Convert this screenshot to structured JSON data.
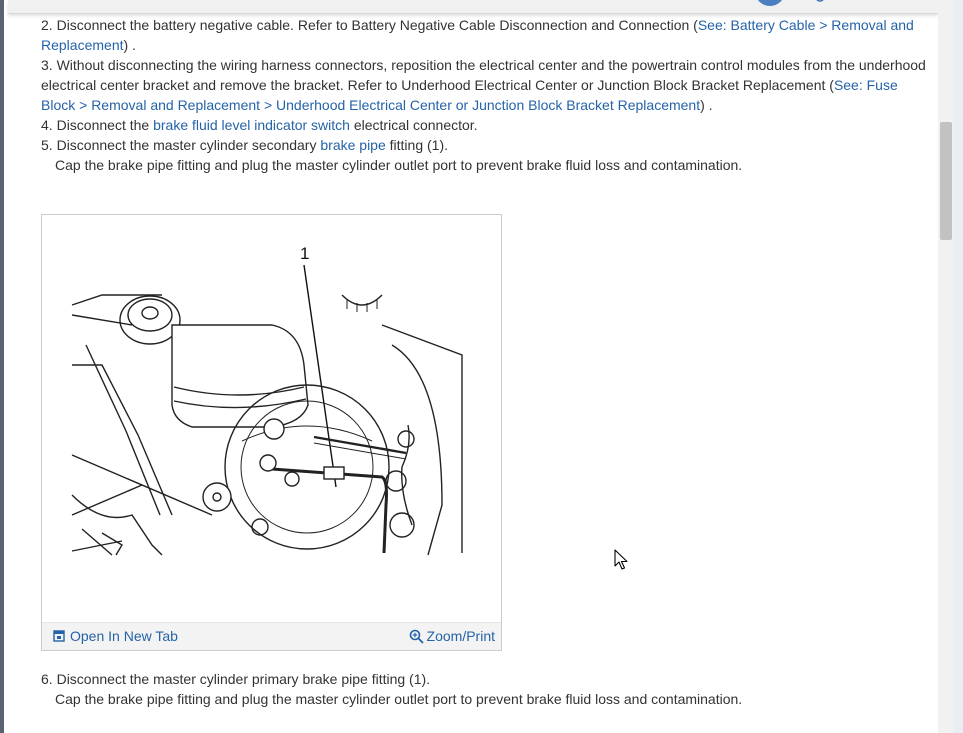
{
  "steps": [
    {
      "num": "2.",
      "text_before": " Disconnect the battery negative cable. Refer to Battery Negative Cable Disconnection and Connection (",
      "link": "See: Battery Cable > Removal and Replacement",
      "text_after": ") ."
    },
    {
      "num": "3.",
      "text_before": " Without disconnecting the wiring harness connectors, reposition the electrical center and the powertrain control modules from the underhood electrical center bracket and remove the bracket. Refer to Underhood Electrical Center or Junction Block Bracket Replacement (",
      "link": "See: Fuse Block > Removal and Replacement > Underhood Electrical Center or Junction Block Bracket Replacement",
      "text_after": ") ."
    },
    {
      "num": "4.",
      "text_before": " Disconnect the ",
      "link": "brake fluid level indicator switch",
      "text_after": " electrical connector."
    },
    {
      "num": "5.",
      "text_before": " Disconnect the master cylinder secondary ",
      "link": "brake pipe",
      "text_after": " fitting (1).",
      "note": "Cap the brake pipe fitting and plug the master cylinder outlet port to prevent brake fluid loss and contamination."
    }
  ],
  "figure": {
    "callout": "1",
    "open_tab_label": "Open In New Tab",
    "zoom_label": "Zoom/Print",
    "open_tab_icon": "open-new-tab-icon",
    "zoom_icon": "magnifier-icon"
  },
  "step6": {
    "num": "6.",
    "text": " Disconnect the master cylinder primary brake pipe fitting (1).",
    "note": "Cap the brake pipe fitting and plug the master cylinder outlet port to prevent brake fluid loss and contamination."
  },
  "colors": {
    "link": "#2563a8",
    "text": "#333333",
    "accent": "#4a7fc2"
  }
}
